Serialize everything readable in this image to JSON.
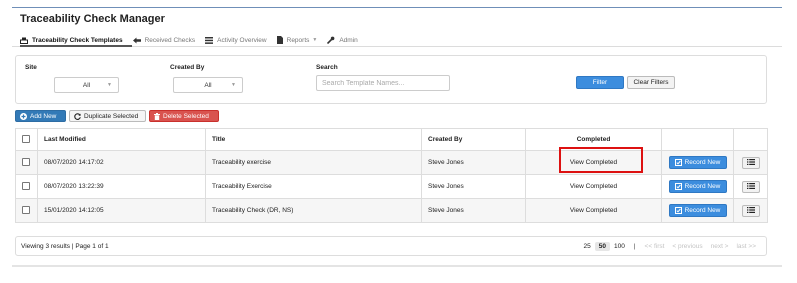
{
  "app": {
    "title": "Traceability Check Manager"
  },
  "tabs": [
    {
      "label": "Traceability Check Templates",
      "icon": "inbox-tray-icon",
      "active": true
    },
    {
      "label": "Received Checks",
      "icon": "arrow-left-icon",
      "active": false
    },
    {
      "label": "Activity Overview",
      "icon": "grid-list-icon",
      "active": false
    },
    {
      "label": "Reports",
      "icon": "document-icon",
      "active": false,
      "has_dropdown": true
    },
    {
      "label": "Admin",
      "icon": "wrench-icon",
      "active": false
    }
  ],
  "filters": {
    "site_label": "Site",
    "site_value": "All",
    "created_by_label": "Created By",
    "created_by_value": "All",
    "search_label": "Search",
    "search_placeholder": "Search Template Names...",
    "filter_button": "Filter",
    "clear_button": "Clear Filters"
  },
  "actions": {
    "add_new": "Add New",
    "duplicate_selected": "Duplicate Selected",
    "delete_selected": "Delete Selected"
  },
  "table": {
    "columns": [
      "Last Modified",
      "Title",
      "Created By",
      "Completed"
    ],
    "rows": [
      {
        "last_modified": "08/07/2020 14:17:02",
        "title": "Traceability exercise",
        "created_by": "Steve Jones",
        "completed": "View Completed",
        "record_label": "Record New"
      },
      {
        "last_modified": "08/07/2020 13:22:39",
        "title": "Traceability Exercise",
        "created_by": "Steve Jones",
        "completed": "View Completed",
        "record_label": "Record New"
      },
      {
        "last_modified": "15/01/2020 14:12:05",
        "title": "Traceability Check (DR, NS)",
        "created_by": "Steve Jones",
        "completed": "View Completed",
        "record_label": "Record New"
      }
    ]
  },
  "pagination": {
    "info": "Viewing 3 results | Page 1 of 1",
    "page_sizes": [
      "25",
      "50",
      "100"
    ],
    "active_page_size": "50",
    "separator": "|",
    "first": "<< first",
    "previous": "< previous",
    "next": "next >",
    "last": "last >>"
  },
  "colors": {
    "primary_button": "#3c8dde",
    "add_button": "#337ab7",
    "delete_button": "#d9534f",
    "highlight_box": "#dd1111"
  }
}
